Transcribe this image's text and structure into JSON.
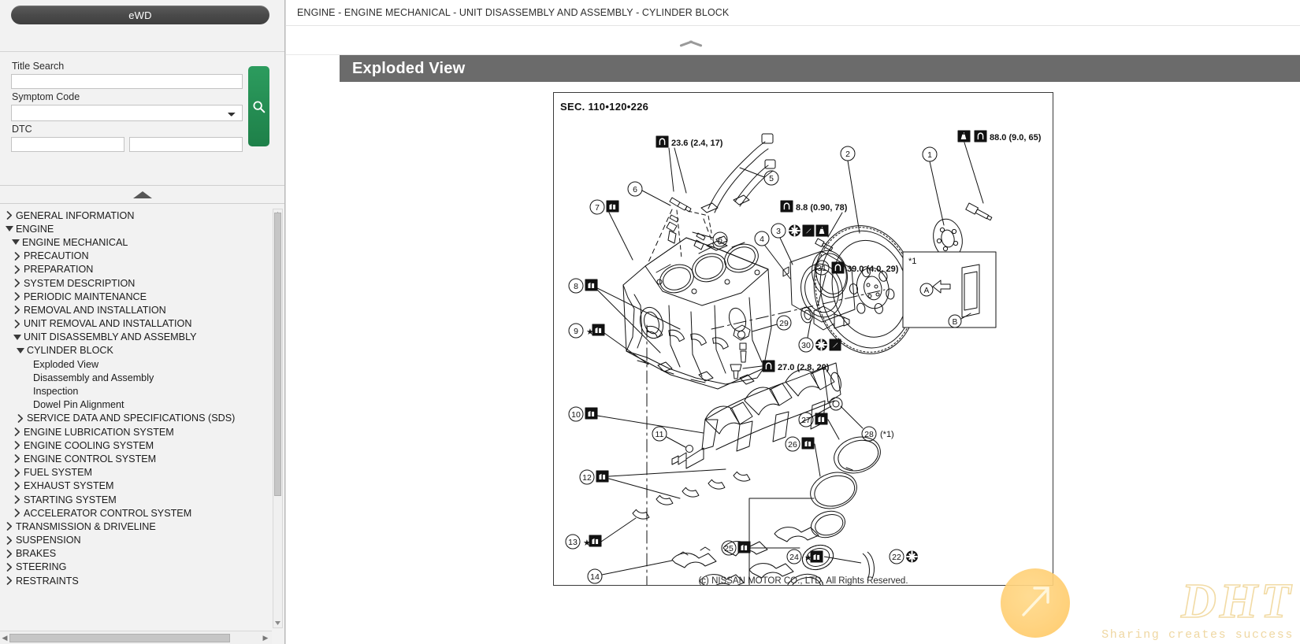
{
  "sidebar": {
    "ewd_button": "eWD",
    "search": {
      "title_search_label": "Title Search",
      "title_search_value": "",
      "title_search_placeholder": "",
      "symptom_code_label": "Symptom Code",
      "symptom_code_value": "",
      "dtc_label": "DTC",
      "dtc_value_1": "",
      "dtc_value_2": "",
      "search_icon": "search-icon",
      "collapse_icon": "triangle-up-icon"
    },
    "tree": [
      {
        "label": "GENERAL INFORMATION",
        "indent": 0,
        "state": "collapsed",
        "star": false
      },
      {
        "label": "ENGINE",
        "indent": 0,
        "state": "expanded",
        "star": false
      },
      {
        "label": "ENGINE MECHANICAL",
        "indent": 1,
        "state": "expanded",
        "star": false
      },
      {
        "label": "PRECAUTION",
        "indent": 2,
        "state": "collapsed",
        "star": false
      },
      {
        "label": "PREPARATION",
        "indent": 2,
        "state": "collapsed",
        "star": false
      },
      {
        "label": "SYSTEM DESCRIPTION",
        "indent": 2,
        "state": "collapsed",
        "star": false
      },
      {
        "label": "PERIODIC MAINTENANCE",
        "indent": 2,
        "state": "collapsed",
        "star": false
      },
      {
        "label": "REMOVAL AND INSTALLATION",
        "indent": 2,
        "state": "collapsed",
        "star": false
      },
      {
        "label": "UNIT REMOVAL AND INSTALLATION",
        "indent": 2,
        "state": "collapsed",
        "star": false
      },
      {
        "label": "UNIT DISASSEMBLY AND ASSEMBLY",
        "indent": 2,
        "state": "expanded",
        "star": false
      },
      {
        "label": "CYLINDER BLOCK",
        "indent": 3,
        "state": "expanded",
        "star": false
      },
      {
        "label": "Exploded View",
        "indent": 4,
        "state": "leaf",
        "star": false
      },
      {
        "label": "Disassembly and Assembly",
        "indent": 4,
        "state": "leaf",
        "star": false
      },
      {
        "label": "Inspection",
        "indent": 4,
        "state": "leaf",
        "star": false
      },
      {
        "label": "Dowel Pin Alignment",
        "indent": 4,
        "state": "leaf",
        "star": false
      },
      {
        "label": "SERVICE DATA AND SPECIFICATIONS (SDS)",
        "indent": 3,
        "state": "collapsed",
        "star": false
      },
      {
        "label": "ENGINE LUBRICATION SYSTEM",
        "indent": 2,
        "state": "collapsed",
        "star": false
      },
      {
        "label": "ENGINE COOLING SYSTEM",
        "indent": 2,
        "state": "collapsed",
        "star": false
      },
      {
        "label": "ENGINE CONTROL SYSTEM",
        "indent": 2,
        "state": "collapsed",
        "star": false
      },
      {
        "label": "FUEL SYSTEM",
        "indent": 2,
        "state": "collapsed",
        "star": false
      },
      {
        "label": "EXHAUST SYSTEM",
        "indent": 2,
        "state": "collapsed",
        "star": false
      },
      {
        "label": "STARTING SYSTEM",
        "indent": 2,
        "state": "collapsed",
        "star": false
      },
      {
        "label": "ACCELERATOR CONTROL SYSTEM",
        "indent": 2,
        "state": "collapsed",
        "star": false
      },
      {
        "label": "TRANSMISSION & DRIVELINE",
        "indent": 0,
        "state": "collapsed",
        "star": false
      },
      {
        "label": "SUSPENSION",
        "indent": 0,
        "state": "collapsed",
        "star": false
      },
      {
        "label": "BRAKES",
        "indent": 0,
        "state": "collapsed",
        "star": false
      },
      {
        "label": "STEERING",
        "indent": 0,
        "state": "collapsed",
        "star": false
      },
      {
        "label": "RESTRAINTS",
        "indent": 0,
        "state": "collapsed",
        "star": false
      }
    ]
  },
  "main": {
    "breadcrumb": "ENGINE - ENGINE MECHANICAL - UNIT DISASSEMBLY AND ASSEMBLY - CYLINDER BLOCK",
    "section_title": "Exploded View",
    "collapse_icon": "chevron-up-icon",
    "copyright": "(c) NISSAN MOTOR CO., LTD. All Rights Reserved."
  },
  "figure": {
    "sec_label": "SEC. 110•120•226",
    "torque_labels": [
      "23.6 (2.4, 17)",
      "88.0 (9.0, 65)",
      "8.8 (0.90, 78)",
      "39.0 (4.0, 29)",
      "27.0 (2.8, 20)"
    ],
    "callouts": [
      "1",
      "2",
      "3",
      "4",
      "5",
      "6",
      "6",
      "7",
      "8",
      "9",
      "10",
      "11",
      "12",
      "13",
      "14",
      "22",
      "24",
      "25",
      "26",
      "27",
      "28",
      "29",
      "30",
      "31"
    ],
    "detail_box": {
      "ref": "*1",
      "marker_a": "A",
      "marker_b": "B"
    },
    "note_ref": "(*1)"
  },
  "watermark": {
    "logo_text": "DHT",
    "tagline": "Sharing creates success",
    "arrow_icon": "arrow-up-right-icon",
    "color": "#f2dba5"
  }
}
